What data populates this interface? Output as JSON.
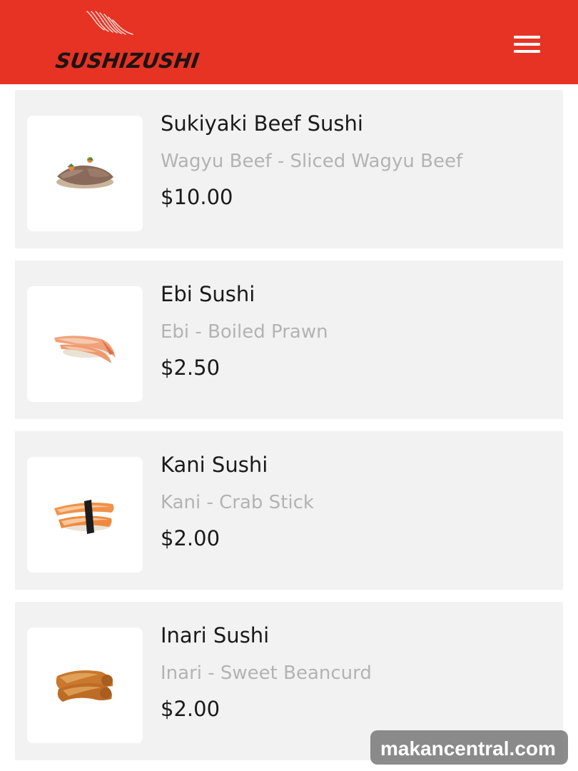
{
  "header": {
    "logo_text": "SUSHIZUSHI",
    "brand_color": "#e63323",
    "menu_icon": "hamburger-menu-icon"
  },
  "items": [
    {
      "name": "Sukiyaki Beef Sushi",
      "description": "Wagyu Beef - Sliced Wagyu Beef",
      "price": "$10.00",
      "image": "beef-sushi-image"
    },
    {
      "name": "Ebi Sushi",
      "description": "Ebi - Boiled Prawn",
      "price": "$2.50",
      "image": "prawn-sushi-image"
    },
    {
      "name": "Kani Sushi",
      "description": "Kani - Crab Stick",
      "price": "$2.00",
      "image": "crab-stick-sushi-image"
    },
    {
      "name": "Inari Sushi",
      "description": "Inari - Sweet Beancurd",
      "price": "$2.00",
      "image": "inari-sushi-image"
    }
  ],
  "watermark": "makancentral.com"
}
